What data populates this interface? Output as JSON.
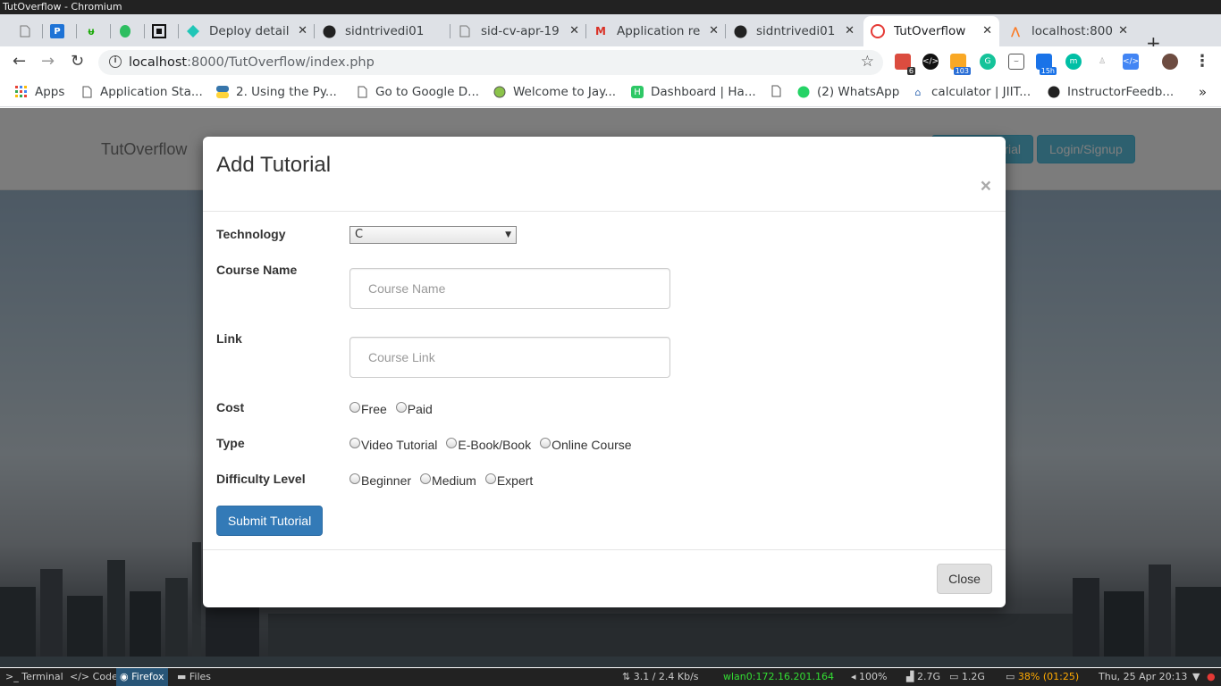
{
  "window": {
    "title": "TutOverflow - Chromium"
  },
  "tabs": [
    {
      "title": "",
      "icon": "file-icon"
    },
    {
      "title": "",
      "icon": "pycharm-icon"
    },
    {
      "title": "",
      "icon": "upwork-icon"
    },
    {
      "title": "",
      "icon": "evernote-icon"
    },
    {
      "title": "",
      "icon": "qr-icon"
    },
    {
      "title": "Deploy detail",
      "icon": "netlify-icon"
    },
    {
      "title": "sidntrivedi01",
      "icon": "github-icon"
    },
    {
      "title": "sid-cv-apr-19",
      "icon": "file-icon"
    },
    {
      "title": "Application re",
      "icon": "gmail-icon"
    },
    {
      "title": "sidntrivedi01",
      "icon": "github-icon"
    },
    {
      "title": "TutOverflow",
      "icon": "tutoverflow-icon"
    },
    {
      "title": "localhost:800",
      "icon": "xampp-icon"
    }
  ],
  "toolbar": {
    "url_host": "localhost",
    "url_rest": ":8000/TutOverflow/index.php",
    "ext_badges": {
      "todoist": "6",
      "feedly": "103",
      "calendar": "15h"
    }
  },
  "bookmarks": [
    {
      "label": "Apps",
      "icon": "apps-grid-icon"
    },
    {
      "label": "Application Sta...",
      "icon": "file-icon"
    },
    {
      "label": "2. Using the Py...",
      "icon": "python-icon"
    },
    {
      "label": "Go to Google D...",
      "icon": "file-icon"
    },
    {
      "label": "Welcome to Jay...",
      "icon": "globe-icon"
    },
    {
      "label": "Dashboard | Ha...",
      "icon": "hackerrank-icon"
    },
    {
      "label": "",
      "icon": "file-icon"
    },
    {
      "label": "(2) WhatsApp",
      "icon": "whatsapp-icon"
    },
    {
      "label": "calculator | JIIT...",
      "icon": "jiit-icon"
    },
    {
      "label": "InstructorFeedb...",
      "icon": "github-icon"
    }
  ],
  "page": {
    "brand": "TutOverflow",
    "nav_add_label": "rial",
    "nav_login_label": "Login/Signup"
  },
  "modal": {
    "title": "Add Tutorial",
    "close_x": "×",
    "technology_label": "Technology",
    "technology_value": "C",
    "course_name_label": "Course Name",
    "course_name_placeholder": "Course Name",
    "link_label": "Link",
    "link_placeholder": "Course Link",
    "cost_label": "Cost",
    "cost_options": [
      "Free",
      "Paid"
    ],
    "type_label": "Type",
    "type_options": [
      "Video Tutorial",
      "E-Book/Book",
      "Online Course"
    ],
    "difficulty_label": "Difficulty Level",
    "difficulty_options": [
      "Beginner",
      "Medium",
      "Expert"
    ],
    "submit_label": "Submit Tutorial",
    "close_label": "Close"
  },
  "statusbar": {
    "workspaces": [
      "Terminal",
      "Code",
      "Firefox",
      "Files"
    ],
    "net_speed": "3.1 / 2.4 Kb/s",
    "wlan": "wlan0:172.16.201.164",
    "volume": "100%",
    "disk": "2.7G",
    "mem": "1.2G",
    "battery": "38% (01:25)",
    "datetime": "Thu, 25 Apr 20:13"
  },
  "colors": {
    "primary_button": "#337ab7",
    "info_button": "#5bc0de",
    "wlan_text": "#33dd33",
    "battery_text": "#ffaa00"
  }
}
